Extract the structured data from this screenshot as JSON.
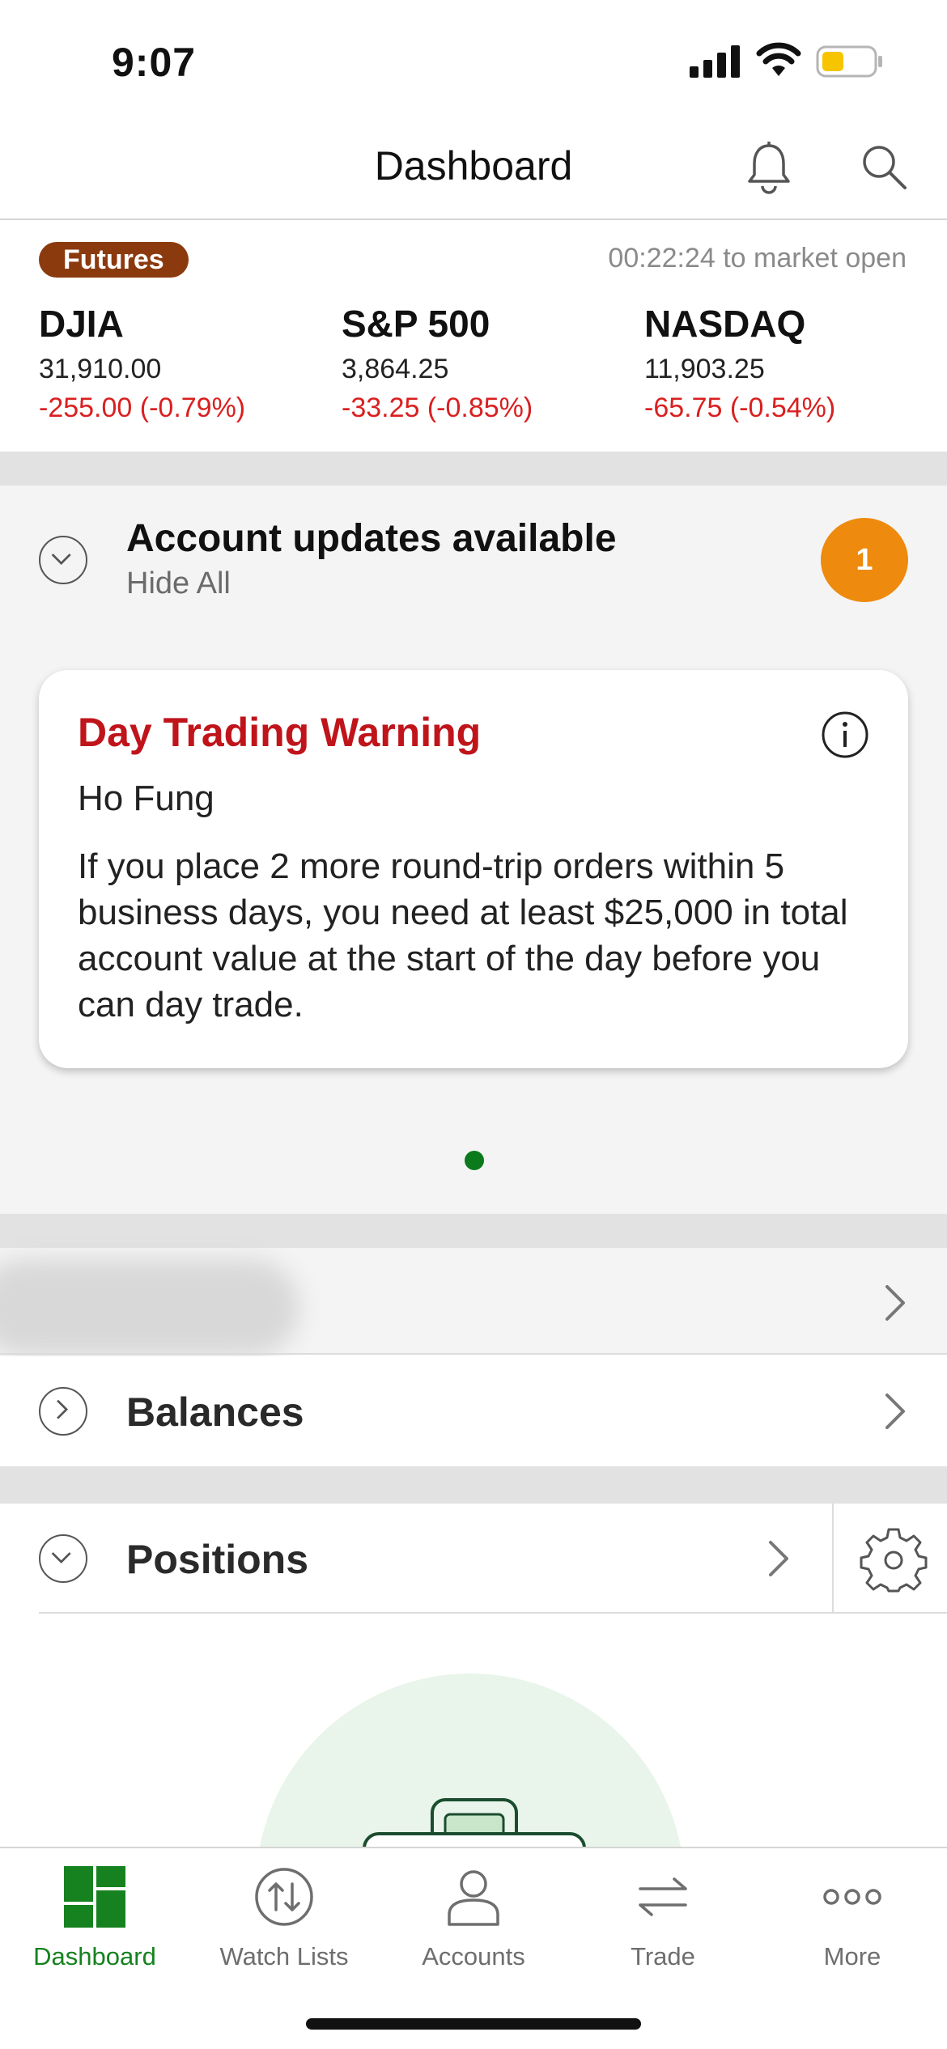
{
  "status_bar": {
    "time": "9:07"
  },
  "header": {
    "title": "Dashboard"
  },
  "futures": {
    "badge": "Futures",
    "market_open": "00:22:24 to market open",
    "indices": [
      {
        "name": "DJIA",
        "value": "31,910.00",
        "change": "-255.00 (-0.79%)"
      },
      {
        "name": "S&P 500",
        "value": "3,864.25",
        "change": "-33.25 (-0.85%)"
      },
      {
        "name": "NASDAQ",
        "value": "11,903.25",
        "change": "-65.75 (-0.54%)"
      }
    ]
  },
  "updates": {
    "title": "Account updates available",
    "hide_all": "Hide All",
    "count": "1",
    "card": {
      "title": "Day Trading Warning",
      "name": "Ho Fung",
      "body": "If you place 2 more round-trip orders within 5 business days, you need at least $25,000 in total account value at the start of the day before you can day trade."
    }
  },
  "rows": {
    "balances": "Balances",
    "positions": "Positions"
  },
  "tabs": [
    {
      "label": "Dashboard",
      "icon": "dashboard-icon",
      "active": true
    },
    {
      "label": "Watch Lists",
      "icon": "watch-lists-icon",
      "active": false
    },
    {
      "label": "Accounts",
      "icon": "accounts-icon",
      "active": false
    },
    {
      "label": "Trade",
      "icon": "trade-icon",
      "active": false
    },
    {
      "label": "More",
      "icon": "more-icon",
      "active": false
    }
  ],
  "colors": {
    "brand_green": "#16821f",
    "negative_red": "#d92020",
    "warning_red": "#c0141b",
    "badge_orange": "#ee8a0d",
    "futures_brown": "#8b3a0e"
  }
}
